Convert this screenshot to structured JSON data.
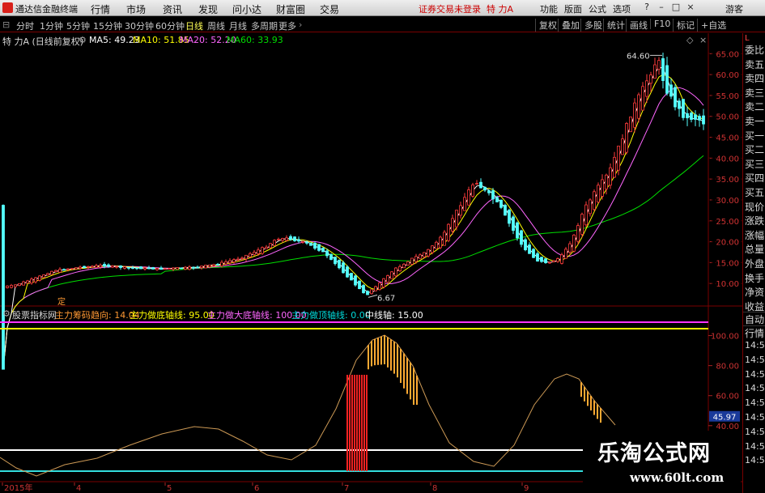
{
  "app": {
    "title": "通达信金融终端",
    "menus": [
      "行情",
      "市场",
      "资讯",
      "发现",
      "问小达",
      "财富圈",
      "交易"
    ],
    "login_notice": "证券交易未登录",
    "stock_name": "特 力A",
    "right_menus": [
      "功能",
      "版面",
      "公式",
      "选项"
    ],
    "guest": "游客"
  },
  "periods": {
    "items": [
      "分时",
      "1分钟",
      "5分钟",
      "15分钟",
      "30分钟",
      "60分钟",
      "日线",
      "周线",
      "月线",
      "多周期",
      "更多"
    ],
    "active": "日线",
    "right_items": [
      "复权",
      "叠加",
      "多股",
      "统计",
      "画线",
      "F10",
      "标记",
      "+自选"
    ]
  },
  "info": {
    "stock": "特 力A (日线前复权)",
    "ma5": "MA5: 49.23",
    "ma10": "MA10: 51.85",
    "ma20": "MA20: 52.20",
    "ma60": "MA60: 33.93",
    "colors": {
      "ma5": "#ffffff",
      "ma10": "#ffff00",
      "ma20": "#ff66ff",
      "ma60": "#00dd00"
    }
  },
  "price_axis": [
    "65.00",
    "60.00",
    "55.00",
    "50.00",
    "45.00",
    "40.00",
    "35.00",
    "30.00",
    "25.00",
    "20.00",
    "15.00",
    "10.00"
  ],
  "price_annotations": {
    "high": "64.60",
    "low": "6.67",
    "marker": "定"
  },
  "indicator": {
    "name": "股票指标网",
    "f1": "主力筹码趋向: 14.04",
    "f2": "主力做底轴线: 95.00",
    "f3": "主力做大底轴线: 100.00",
    "f4": "主力做顶轴线: 0.00",
    "f5": "中线轴: 15.00",
    "axis": [
      "100.00",
      "80.00",
      "60.00",
      "40.00"
    ],
    "current": "45.97"
  },
  "time_axis": [
    "2015年",
    "4",
    "5",
    "6",
    "7",
    "8",
    "9"
  ],
  "right_panel": {
    "quote_items": [
      "委比",
      "卖五",
      "卖四",
      "卖三",
      "卖二",
      "卖一",
      "买一",
      "买二",
      "买三",
      "买四",
      "买五",
      "现价",
      "涨跌",
      "涨幅",
      "总量",
      "外盘",
      "换手",
      "净资",
      "收益"
    ],
    "tabs": [
      "自动",
      "行情"
    ],
    "times": [
      "14:5",
      "14:5",
      "14:5",
      "14:5",
      "14:5",
      "14:5",
      "14:5",
      "14:5",
      "14:5"
    ]
  },
  "watermark": {
    "title": "乐淘公式网",
    "url": "www.60lt.com"
  }
}
